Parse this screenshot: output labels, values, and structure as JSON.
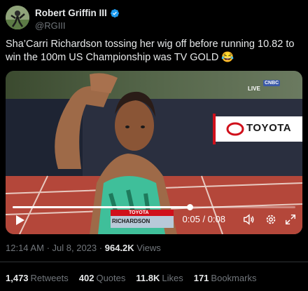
{
  "author": {
    "display_name": "Robert Griffin III",
    "handle": "@RGIII",
    "verified_icon": "verified-badge-icon",
    "avatar_icon": "avatar-image"
  },
  "tweet": {
    "text": "Sha’Carri Richardson tossing her wig off before running 10.82 to win the 100m US Championship was TV GOLD 😂"
  },
  "video": {
    "live_badge": "LIVE",
    "network_badge": "CNBC",
    "sponsor_text": "TOYOTA",
    "bib_sponsor": "TOYOTA",
    "bib_name": "RICHARDSON",
    "time_label": "0:05 / 0:08",
    "progress": 0.625,
    "icons": [
      "play-icon",
      "volume-icon",
      "settings-gear-icon",
      "fullscreen-icon"
    ]
  },
  "meta": {
    "time": "12:14 AM",
    "date": "Jul 8, 2023",
    "views_count": "964.2K",
    "views_label": "Views",
    "separator": "·"
  },
  "stats": {
    "retweets_count": "1,473",
    "retweets_label": "Retweets",
    "quotes_count": "402",
    "quotes_label": "Quotes",
    "likes_count": "11.8K",
    "likes_label": "Likes",
    "bookmarks_count": "171",
    "bookmarks_label": "Bookmarks"
  },
  "colors": {
    "background": "#000000",
    "text_primary": "#e7e9ea",
    "text_secondary": "#71767b",
    "verified": "#1d9bf0"
  }
}
